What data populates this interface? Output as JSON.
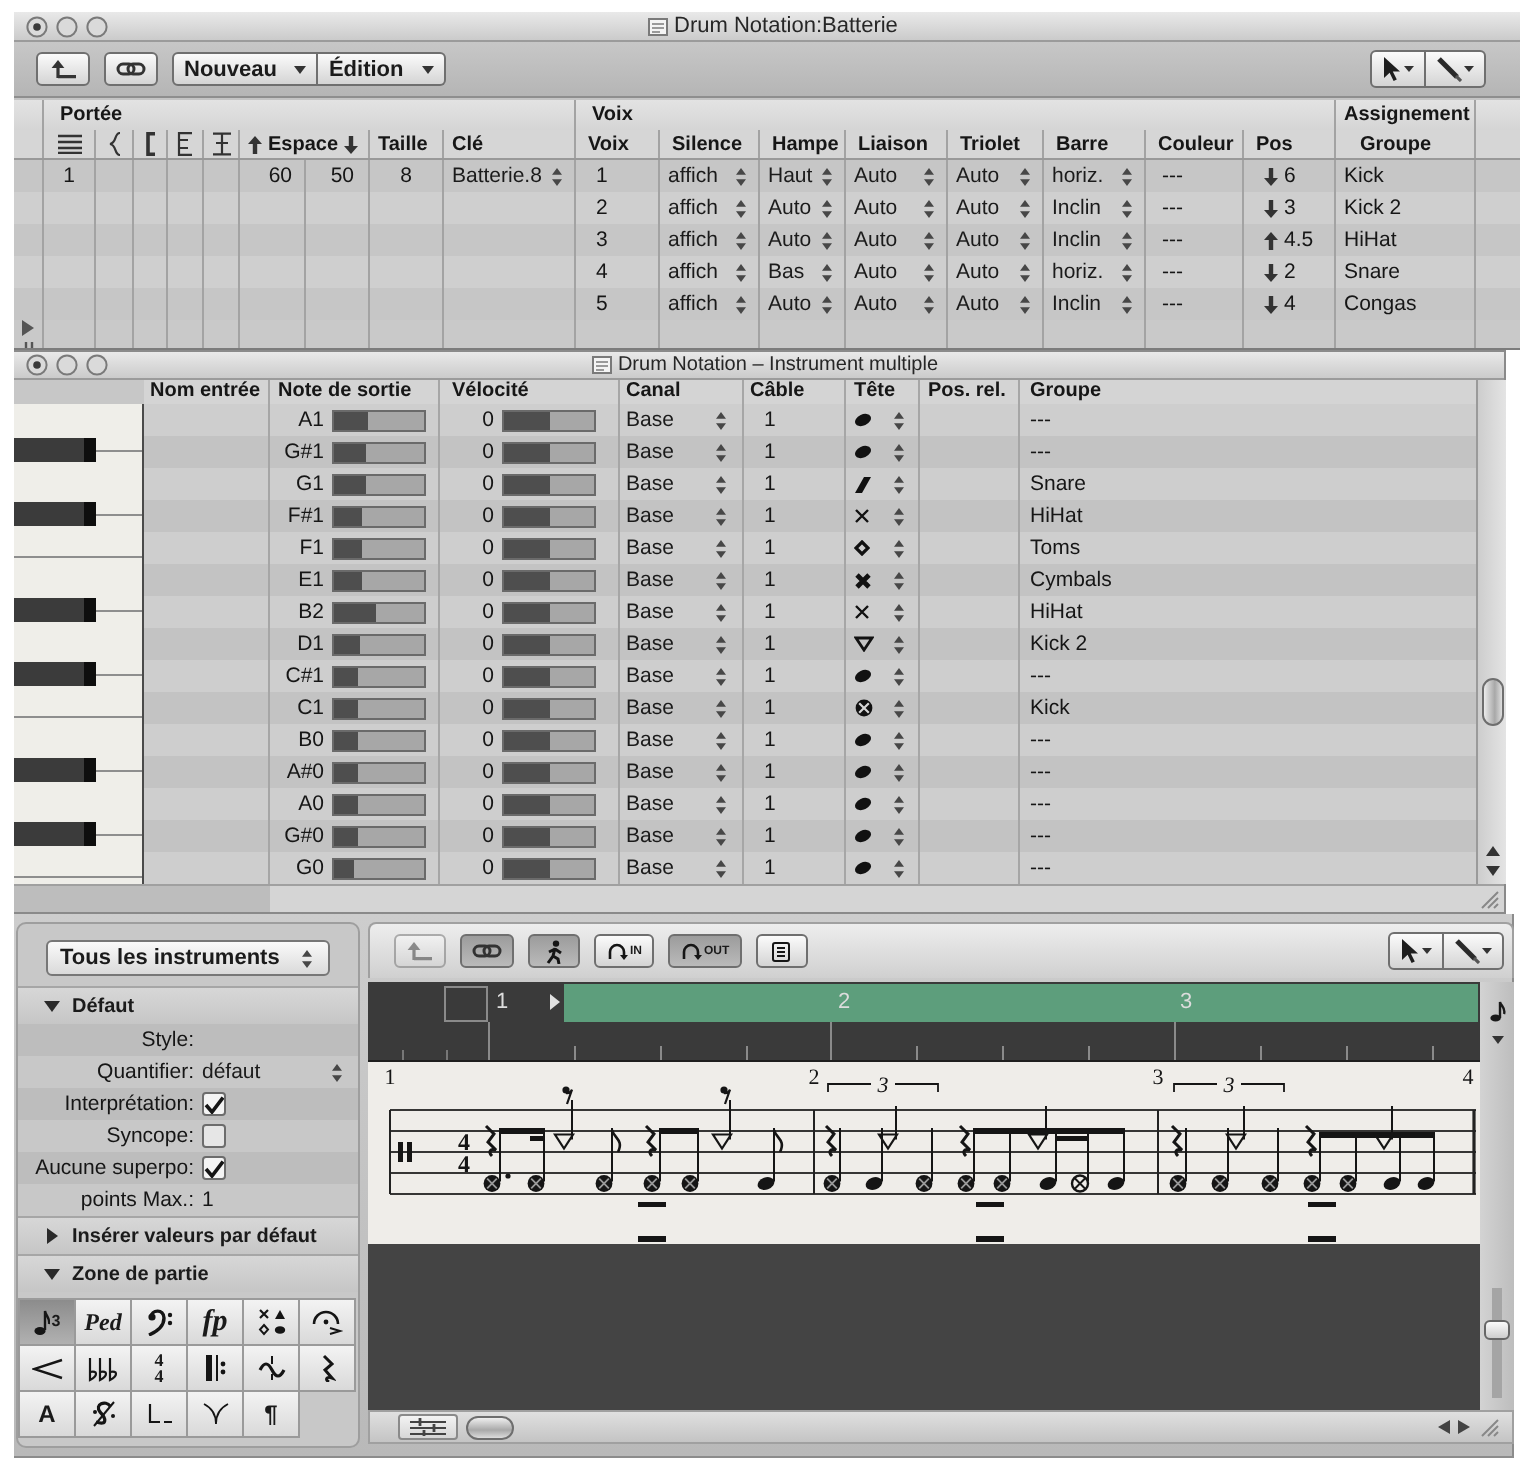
{
  "top_window": {
    "title": "Drum Notation:Batterie",
    "toolbar": {
      "menus": [
        {
          "label": "Nouveau"
        },
        {
          "label": "Édition"
        }
      ]
    },
    "groups": [
      {
        "label": "Portée"
      },
      {
        "label": "Voix"
      },
      {
        "label": "Assignement"
      }
    ],
    "staff_headers": {
      "space": "Espace",
      "size": "Taille",
      "clef": "Clé"
    },
    "voice_headers": [
      "Voix",
      "Silence",
      "Hampe",
      "Liaison",
      "Triolet",
      "Barre",
      "Couleur",
      "Pos"
    ],
    "assign_headers": [
      "Groupe"
    ],
    "staves": [
      {
        "number": "1",
        "space_above": "60",
        "space_below": "50",
        "size": "8",
        "clef": "Batterie.8"
      }
    ],
    "voices": [
      {
        "voice": "1",
        "rest": "affich",
        "stem": "Haut",
        "tie": "Auto",
        "tuplet": "Auto",
        "beam": "horiz.",
        "couleur": "---",
        "pos": {
          "up": false,
          "value": "6"
        },
        "group": "Kick"
      },
      {
        "voice": "2",
        "rest": "affich",
        "stem": "Auto",
        "tie": "Auto",
        "tuplet": "Auto",
        "beam": "Inclin",
        "couleur": "---",
        "pos": {
          "up": false,
          "value": "3"
        },
        "group": "Kick 2"
      },
      {
        "voice": "3",
        "rest": "affich",
        "stem": "Auto",
        "tie": "Auto",
        "tuplet": "Auto",
        "beam": "Inclin",
        "couleur": "---",
        "pos": {
          "up": true,
          "value": "4.5"
        },
        "group": "HiHat"
      },
      {
        "voice": "4",
        "rest": "affich",
        "stem": "Bas",
        "tie": "Auto",
        "tuplet": "Auto",
        "beam": "horiz.",
        "couleur": "---",
        "pos": {
          "up": false,
          "value": "2"
        },
        "group": "Snare"
      },
      {
        "voice": "5",
        "rest": "affich",
        "stem": "Auto",
        "tie": "Auto",
        "tuplet": "Auto",
        "beam": "Inclin",
        "couleur": "---",
        "pos": {
          "up": false,
          "value": "4"
        },
        "group": "Congas"
      }
    ]
  },
  "instrument_window": {
    "title": "Drum Notation – Instrument multiple",
    "headers": [
      "Nom entrée",
      "Note de sortie",
      "Vélocité",
      "Canal",
      "Câble",
      "Tête",
      "Pos. rel.",
      "Groupe"
    ],
    "rows": [
      {
        "output": {
          "note": "A1",
          "level": 0.37
        },
        "velocity": {
          "value": "0",
          "level": 0.5
        },
        "channel": "Base",
        "cable": "1",
        "head": {
          "kind": "normal"
        },
        "group": "---"
      },
      {
        "output": {
          "note": "G#1",
          "level": 0.35
        },
        "velocity": {
          "value": "0",
          "level": 0.5
        },
        "channel": "Base",
        "cable": "1",
        "head": {
          "kind": "normal"
        },
        "group": "---"
      },
      {
        "output": {
          "note": "G1",
          "level": 0.35
        },
        "velocity": {
          "value": "0",
          "level": 0.5
        },
        "channel": "Base",
        "cable": "1",
        "head": {
          "kind": "slash"
        },
        "group": "Snare"
      },
      {
        "output": {
          "note": "F#1",
          "level": 0.32
        },
        "velocity": {
          "value": "0",
          "level": 0.5
        },
        "channel": "Base",
        "cable": "1",
        "head": {
          "kind": "cross"
        },
        "group": "HiHat"
      },
      {
        "output": {
          "note": "F1",
          "level": 0.32
        },
        "velocity": {
          "value": "0",
          "level": 0.5
        },
        "channel": "Base",
        "cable": "1",
        "head": {
          "kind": "diamond"
        },
        "group": "Toms"
      },
      {
        "output": {
          "note": "E1",
          "level": 0.32
        },
        "velocity": {
          "value": "0",
          "level": 0.5
        },
        "channel": "Base",
        "cable": "1",
        "head": {
          "kind": "heavycross"
        },
        "group": "Cymbals"
      },
      {
        "output": {
          "note": "B2",
          "level": 0.47
        },
        "velocity": {
          "value": "0",
          "level": 0.5
        },
        "channel": "Base",
        "cable": "1",
        "head": {
          "kind": "cross"
        },
        "group": "HiHat"
      },
      {
        "output": {
          "note": "D1",
          "level": 0.29
        },
        "velocity": {
          "value": "0",
          "level": 0.5
        },
        "channel": "Base",
        "cable": "1",
        "head": {
          "kind": "triangle"
        },
        "group": "Kick 2"
      },
      {
        "output": {
          "note": "C#1",
          "level": 0.27
        },
        "velocity": {
          "value": "0",
          "level": 0.5
        },
        "channel": "Base",
        "cable": "1",
        "head": {
          "kind": "normal"
        },
        "group": "---"
      },
      {
        "output": {
          "note": "C1",
          "level": 0.27
        },
        "velocity": {
          "value": "0",
          "level": 0.5
        },
        "channel": "Base",
        "cable": "1",
        "head": {
          "kind": "circlecross"
        },
        "group": "Kick"
      },
      {
        "output": {
          "note": "B0",
          "level": 0.27
        },
        "velocity": {
          "value": "0",
          "level": 0.5
        },
        "channel": "Base",
        "cable": "1",
        "head": {
          "kind": "normal"
        },
        "group": "---"
      },
      {
        "output": {
          "note": "A#0",
          "level": 0.26
        },
        "velocity": {
          "value": "0",
          "level": 0.5
        },
        "channel": "Base",
        "cable": "1",
        "head": {
          "kind": "normal"
        },
        "group": "---"
      },
      {
        "output": {
          "note": "A0",
          "level": 0.26
        },
        "velocity": {
          "value": "0",
          "level": 0.5
        },
        "channel": "Base",
        "cable": "1",
        "head": {
          "kind": "normal"
        },
        "group": "---"
      },
      {
        "output": {
          "note": "G#0",
          "level": 0.26
        },
        "velocity": {
          "value": "0",
          "level": 0.5
        },
        "channel": "Base",
        "cable": "1",
        "head": {
          "kind": "normal"
        },
        "group": "---"
      },
      {
        "output": {
          "note": "G0",
          "level": 0.23
        },
        "velocity": {
          "value": "0",
          "level": 0.5
        },
        "channel": "Base",
        "cable": "1",
        "head": {
          "kind": "normal"
        },
        "group": "---"
      }
    ]
  },
  "score_window": {
    "inspector": {
      "instrument_menu": "Tous les instruments",
      "sections": [
        {
          "title": "Défaut",
          "expanded": true,
          "fields": [
            {
              "kind": "text",
              "label": "Style:"
            },
            {
              "kind": "select",
              "label": "Quantifier:",
              "value": "défaut"
            },
            {
              "kind": "checkbox",
              "label": "Interprétation:",
              "checked": true
            },
            {
              "kind": "checkbox",
              "label": "Syncope:",
              "checked": false
            },
            {
              "kind": "checkbox",
              "label": "Aucune superpo:",
              "checked": true
            },
            {
              "kind": "value",
              "label": "points Max.:",
              "value": "1"
            }
          ]
        },
        {
          "title": "Insérer valeurs par défaut",
          "expanded": false
        },
        {
          "title": "Zone de partie",
          "expanded": true,
          "palette": [
            {
              "kind": "notes",
              "label": "3",
              "selected": true
            },
            {
              "kind": "pedal",
              "label": "Ped",
              "selected": false
            },
            {
              "kind": "bassclef",
              "selected": false
            },
            {
              "kind": "dynamic",
              "label": "fp",
              "selected": false
            },
            {
              "kind": "noteheads",
              "selected": false
            },
            {
              "kind": "fermata",
              "selected": false
            },
            {
              "kind": "hairpin",
              "selected": false
            },
            {
              "kind": "flats",
              "selected": false
            },
            {
              "kind": "time",
              "numerator": "4",
              "denominator": "4",
              "selected": false
            },
            {
              "kind": "repeat",
              "selected": false
            },
            {
              "kind": "ornament",
              "selected": false
            },
            {
              "kind": "rest",
              "selected": false
            },
            {
              "kind": "text",
              "label": "A",
              "selected": false
            },
            {
              "kind": "segno",
              "selected": false
            },
            {
              "kind": "bracket",
              "selected": false
            },
            {
              "kind": "curves",
              "selected": false
            },
            {
              "kind": "text",
              "label": "¶",
              "selected": false
            }
          ]
        }
      ]
    },
    "toolbar": [
      {
        "kind": "back",
        "pressed": false,
        "disabled": true
      },
      {
        "kind": "link",
        "pressed": true,
        "disabled": false
      },
      {
        "kind": "walk",
        "pressed": true,
        "disabled": false
      },
      {
        "kind": "in",
        "label": "IN",
        "pressed": false,
        "disabled": false
      },
      {
        "kind": "out",
        "label": "OUT",
        "pressed": true,
        "disabled": false
      },
      {
        "kind": "list",
        "pressed": false,
        "disabled": false
      }
    ],
    "ruler": {
      "bars": [
        "1",
        "2",
        "3"
      ],
      "cycle": true
    },
    "zoom_slider": {
      "level": 0.64
    },
    "score": {
      "measure_numbers": [
        "1",
        "2",
        "3",
        "4"
      ],
      "tuplets": [
        "3",
        "3"
      ],
      "time_signature": {
        "numerator": "4",
        "denominator": "4"
      }
    }
  }
}
